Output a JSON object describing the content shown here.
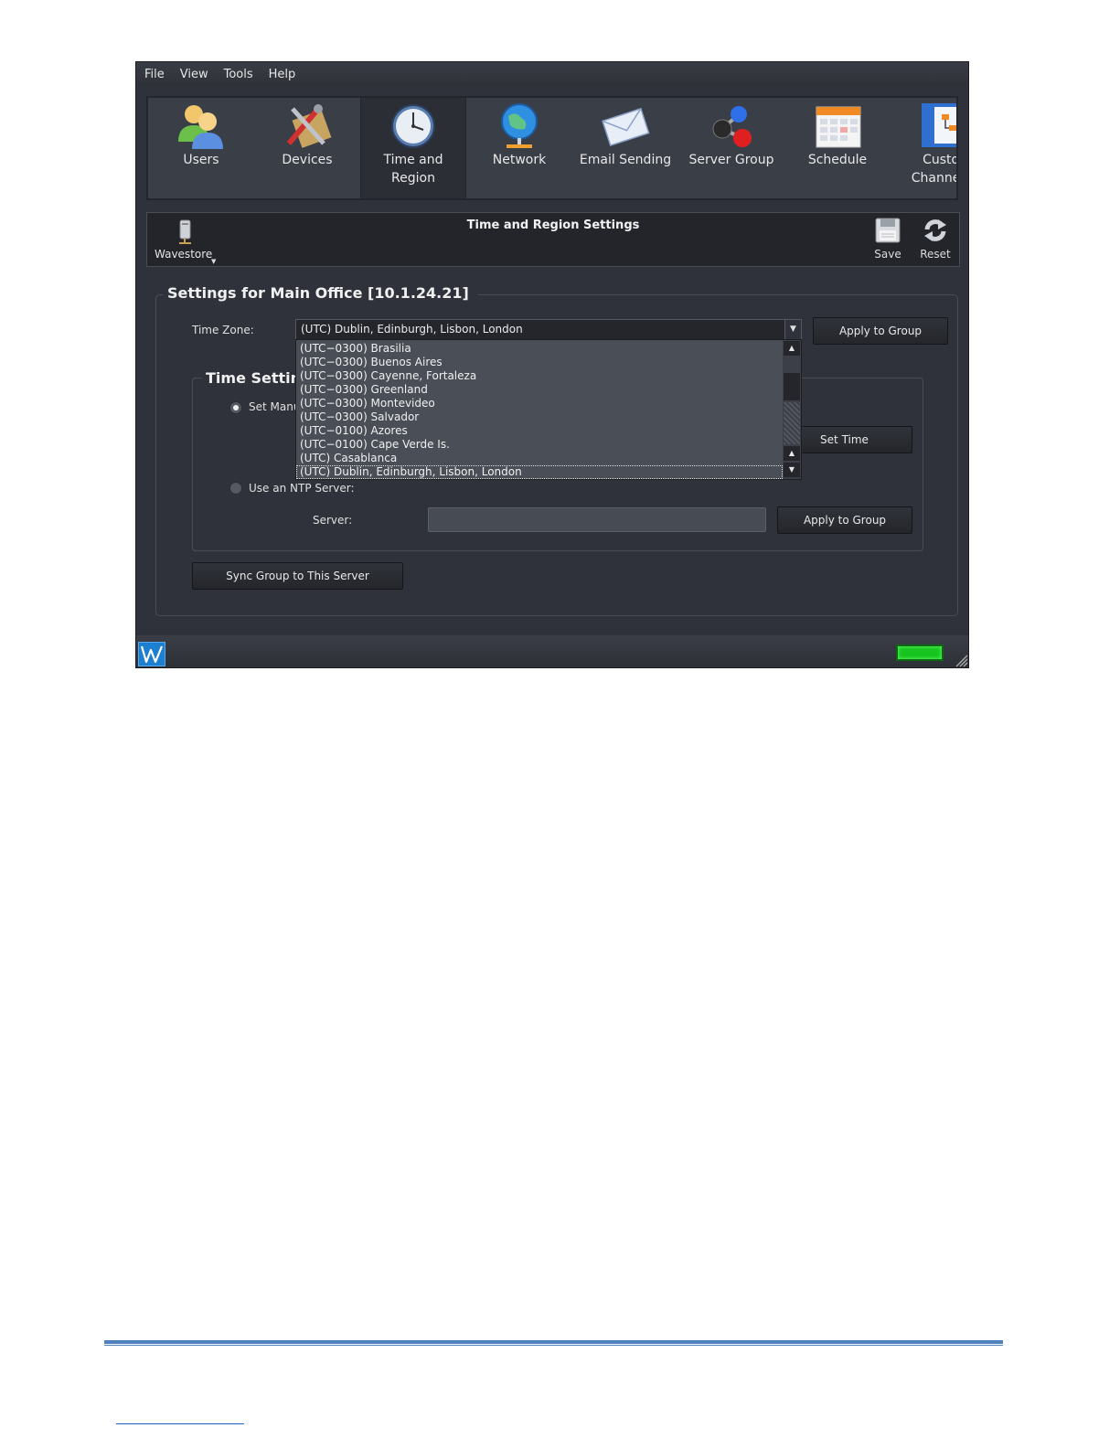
{
  "menu": [
    "File",
    "View",
    "Tools",
    "Help"
  ],
  "toolbar": [
    {
      "label": "Users",
      "icon": "users-icon"
    },
    {
      "label": "Devices",
      "icon": "devices-icon"
    },
    {
      "label": "Time and\nRegion",
      "icon": "clock-icon",
      "active": true
    },
    {
      "label": "Network",
      "icon": "globe-network-icon"
    },
    {
      "label": "Email Sending",
      "icon": "envelope-icon"
    },
    {
      "label": "Server Group",
      "icon": "molecule-icon"
    },
    {
      "label": "Schedule",
      "icon": "calendar-icon"
    },
    {
      "label": "Custor\nChannel T",
      "icon": "channel-tree-icon"
    }
  ],
  "subbar": {
    "title": "Time and Region Settings",
    "server_menu": "Wavestore",
    "save": "Save",
    "reset": "Reset"
  },
  "settings": {
    "group_title": "Settings for Main Office [10.1.24.21]",
    "time_zone_label": "Time Zone:",
    "time_zone_value": "(UTC) Dublin, Edinburgh, Lisbon, London",
    "apply_to_group": "Apply to Group",
    "time_settings_title": "Time Setting",
    "set_manual_label": "Set Manu",
    "set_time": "Set Time",
    "ntp_label": "Use an NTP Server:",
    "server_label": "Server:",
    "server_value": "",
    "apply_to_group_2": "Apply to Group",
    "sync_group": "Sync Group to This Server"
  },
  "dropdown_options": [
    "(UTC−0300) Brasilia",
    "(UTC−0300) Buenos Aires",
    "(UTC−0300) Cayenne, Fortaleza",
    "(UTC−0300) Greenland",
    "(UTC−0300) Montevideo",
    "(UTC−0300) Salvador",
    "(UTC−0100) Azores",
    "(UTC−0100) Cape Verde Is.",
    "(UTC) Casablanca",
    "(UTC) Dublin, Edinburgh, Lisbon, London"
  ],
  "colors": {
    "status_led": "#15c41d",
    "footer_rule": "#4f81bd"
  }
}
